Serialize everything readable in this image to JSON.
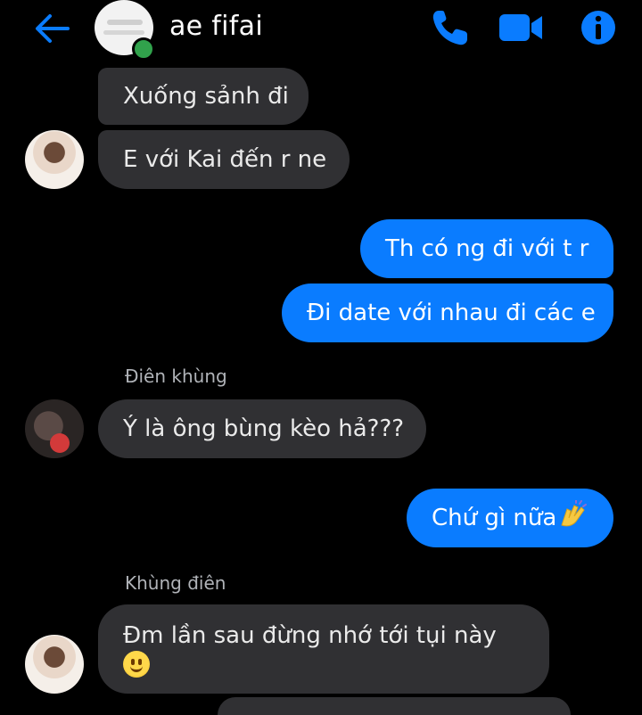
{
  "header": {
    "title": "ae fifai",
    "back_icon": "arrow-left-icon",
    "call_icon": "phone-icon",
    "video_icon": "video-camera-icon",
    "info_icon": "info-icon",
    "accent_color": "#0a7cff"
  },
  "messages": [
    {
      "side": "in",
      "text": "Xuống sảnh đi"
    },
    {
      "side": "in",
      "text": "E với Kai đến r ne"
    },
    {
      "side": "out",
      "text": "Th có ng đi với t r"
    },
    {
      "side": "out",
      "text": "Đi date với nhau đi các e"
    },
    {
      "side": "in",
      "sender": "Điên khùng",
      "text": "Ý là ông bùng kèo hả???"
    },
    {
      "side": "out",
      "text": "Chứ gì nữa",
      "emoji": "raising-hands-emoji"
    },
    {
      "side": "in",
      "sender": "Khùng điên",
      "text": "Đm lần sau đừng nhớ tới tụi này",
      "emoji": "smiling-face-emoji"
    }
  ]
}
